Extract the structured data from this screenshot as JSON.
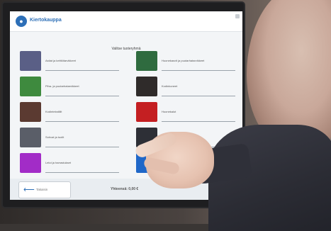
{
  "app": {
    "logo_text": "Kiertokauppa"
  },
  "page": {
    "heading": "Valitse tuoteryhmä"
  },
  "tiles": [
    {
      "label": "Astiat ja keittiötarvikkeet",
      "color": "#5a5f86",
      "icon": "pan-icon"
    },
    {
      "label": "Huonekasvit ja puutarhatarvikkeet",
      "color": "#2f6b3f",
      "icon": "plant-icon"
    },
    {
      "label": "Piha- ja puutarhatarvikkeet",
      "color": "#3e8a3e",
      "icon": "branch-icon"
    },
    {
      "label": "Kodinkoneet",
      "color": "#2f2b2a",
      "icon": "appliance-icon"
    },
    {
      "label": "Kodintekstiilit",
      "color": "#5b3a31",
      "icon": "bottle-icon"
    },
    {
      "label": "Huonekalut",
      "color": "#c41f22",
      "icon": "fence-icon"
    },
    {
      "label": "Sohvat ja tuolit",
      "color": "#5a5e68",
      "icon": "sofa-icon"
    },
    {
      "label": "Sängyt",
      "color": "#2d2f36",
      "icon": "bed-icon"
    },
    {
      "label": "Lelut ja harrastukset",
      "color": "#a22cc7",
      "icon": "toy-icon"
    },
    {
      "label": "Muut",
      "color": "#1f67c8",
      "icon": "misc-icon"
    }
  ],
  "footer": {
    "back_label": "Takaisin",
    "total_label": "Yhteensä: 0,00 €"
  },
  "colors": {
    "accent": "#2d6fb7"
  }
}
